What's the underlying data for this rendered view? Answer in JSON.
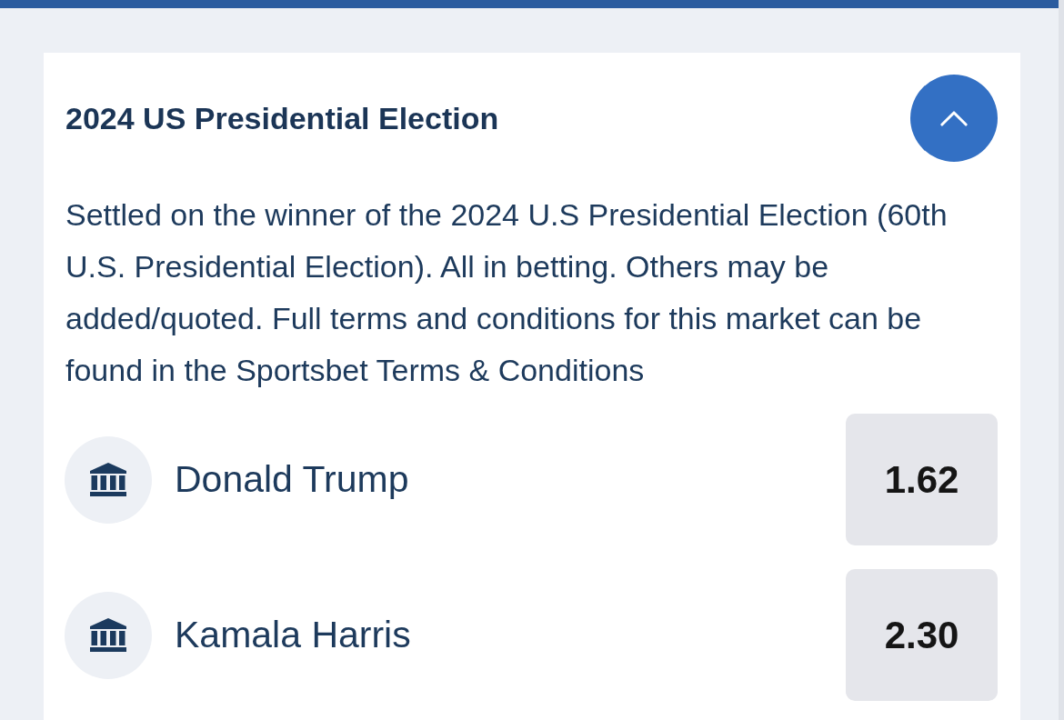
{
  "market": {
    "title": "2024 US Presidential Election",
    "expanded": true,
    "description": "Settled on the winner of the 2024 U.S Presidential Election (60th U.S. Presidential Election). All in betting. Others may be added/quoted. Full terms and conditions for this market can be found in the Sportsbet Terms & Conditions",
    "selections": [
      {
        "name": "Donald Trump",
        "odds": "1.62",
        "selected": false
      },
      {
        "name": "Kamala Harris",
        "odds": "2.30",
        "selected": false
      }
    ]
  }
}
